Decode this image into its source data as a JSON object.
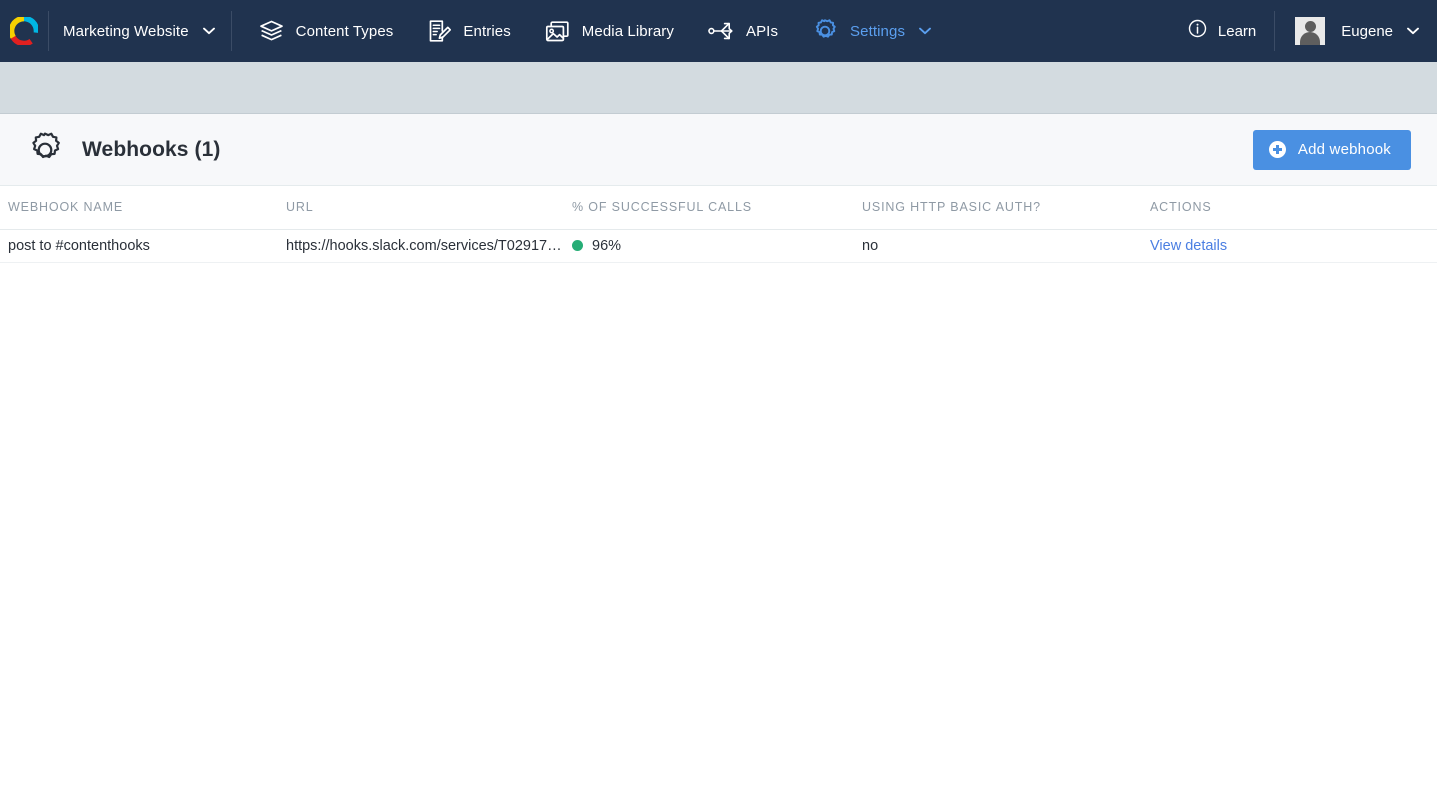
{
  "navbar": {
    "logo": "contentful-logo",
    "space": {
      "name": "Marketing Website",
      "caret_icon": "chevron-down-icon"
    },
    "items": [
      {
        "label": "Content Types",
        "icon": "layers-icon",
        "active": false
      },
      {
        "label": "Entries",
        "icon": "document-pencil-icon",
        "active": false
      },
      {
        "label": "Media Library",
        "icon": "image-stack-icon",
        "active": false
      },
      {
        "label": "APIs",
        "icon": "api-fork-icon",
        "active": false
      },
      {
        "label": "Settings",
        "icon": "gear-icon",
        "active": true
      }
    ],
    "learn": {
      "label": "Learn",
      "icon": "info-circle-icon"
    },
    "user": {
      "name": "Eugene",
      "avatar": "user-avatar",
      "caret_icon": "chevron-down-icon"
    }
  },
  "header": {
    "icon": "gear-icon",
    "title": "Webhooks (1)",
    "add_button": {
      "label": "Add webhook",
      "icon": "plus-circle-icon"
    }
  },
  "table": {
    "columns": [
      "WEBHOOK NAME",
      "URL",
      "% OF SUCCESSFUL CALLS",
      "USING HTTP BASIC AUTH?",
      "ACTIONS"
    ],
    "rows": [
      {
        "name": "post to #contenthooks",
        "url": "https://hooks.slack.com/services/T02917…",
        "success_rate": "96%",
        "status_color": "#26ad76",
        "basic_auth": "no",
        "action_label": "View details"
      }
    ]
  },
  "colors": {
    "navbar_bg": "#20334f",
    "accent_blue": "#4a90e2",
    "link_blue": "#4a7ee2",
    "active_nav": "#5b9fef",
    "band_grey": "#d3dbe0",
    "header_bg": "#f7f8fa",
    "status_green": "#26ad76"
  }
}
